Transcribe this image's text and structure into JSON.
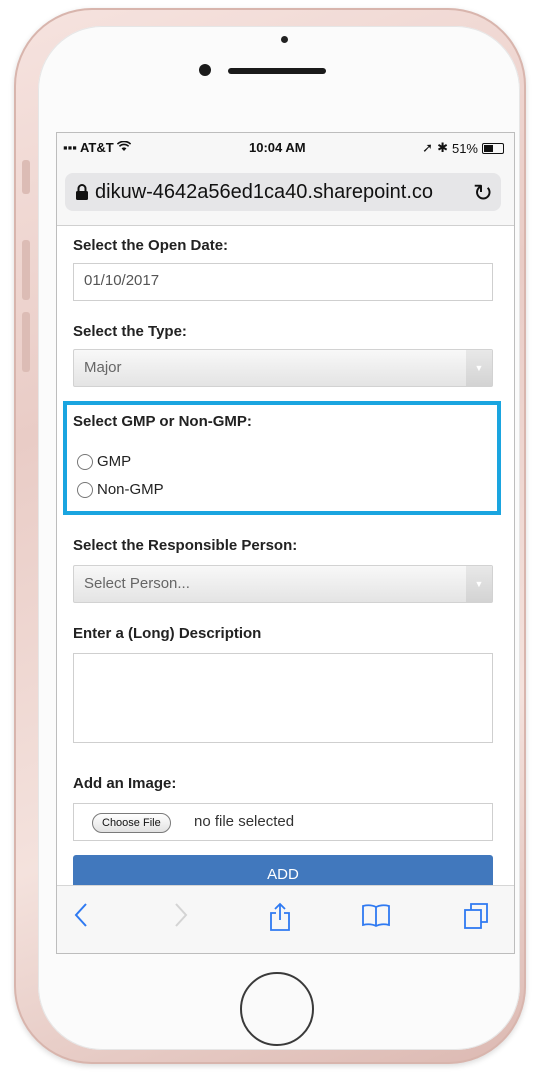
{
  "status_bar": {
    "carrier": "AT&T",
    "time": "10:04 AM",
    "battery_percent": "51%",
    "battery_level": 0.51
  },
  "url_bar": {
    "url": "dikuw-4642a56ed1ca40.sharepoint.co"
  },
  "form": {
    "open_date_label": "Select the Open Date:",
    "open_date_value": "01/10/2017",
    "type_label": "Select the Type:",
    "type_value": "Major",
    "gmp_label": "Select GMP or Non-GMP:",
    "gmp_options": [
      "GMP",
      "Non-GMP"
    ],
    "responsible_label": "Select the Responsible Person:",
    "responsible_placeholder": "Select Person...",
    "description_label": "Enter a (Long) Description",
    "description_value": "",
    "image_label": "Add an Image:",
    "choose_file_label": "Choose File",
    "no_file_text": "no file selected",
    "add_button_label": "ADD"
  },
  "toolbar": {
    "icons": [
      "back-icon",
      "forward-icon",
      "share-icon",
      "bookmarks-icon",
      "tabs-icon"
    ]
  },
  "colors": {
    "highlight": "#1aa5e0",
    "add_button": "#4178bd",
    "ios_blue": "#2f7af2"
  }
}
